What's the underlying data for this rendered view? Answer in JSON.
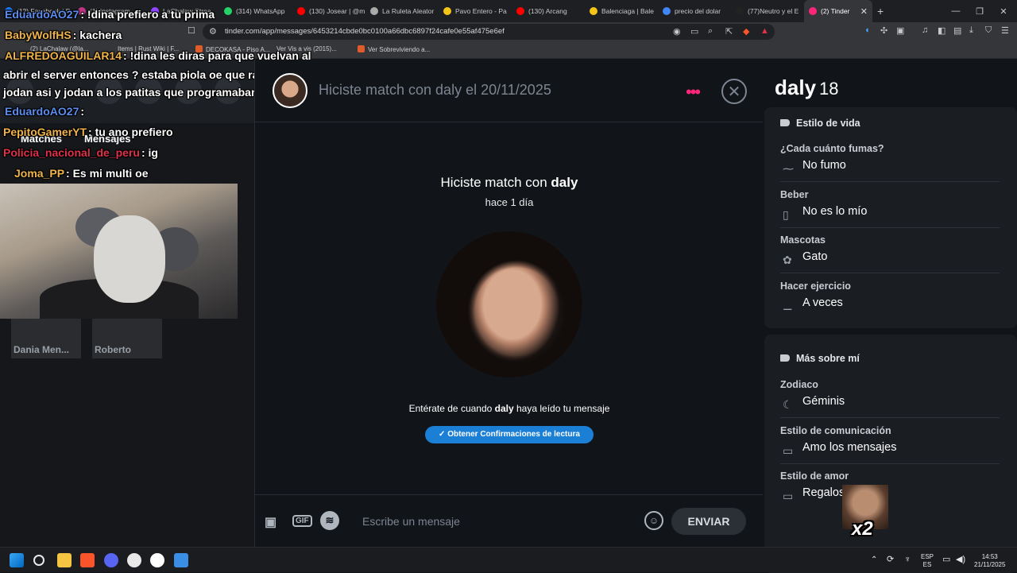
{
  "browser": {
    "tabs": [
      {
        "label": "(12) Facebook | P",
        "color": "#1877f2"
      },
      {
        "label": "(1) Instagram",
        "color": "#c13584"
      },
      {
        "label": "LaChalaw Strea",
        "color": "#9146ff"
      },
      {
        "label": "(314) WhatsApp",
        "color": "#25d366"
      },
      {
        "label": "(130) Josear | @m",
        "color": "#ff0000"
      },
      {
        "label": "La Ruleta Aleator",
        "color": "#aaaaaa"
      },
      {
        "label": "Pavo Entero - Pa",
        "color": "#f5c518"
      },
      {
        "label": "(130) Arcang",
        "color": "#ff0000"
      },
      {
        "label": "Balenciaga | Bale",
        "color": "#f5c518"
      },
      {
        "label": "precio del dolar",
        "color": "#4285f4"
      },
      {
        "label": "(77)Neutro y el E",
        "color": "#222222"
      }
    ],
    "active_tab": {
      "label": "(2) Tinder",
      "color": "#fd267a",
      "close": "✕"
    },
    "new_tab": "+",
    "url": "tinder.com/app/messages/6453214cbde0bc0100a66dbc6897f24cafe0e55af475e6ef",
    "bookmarks": [
      "(2) LaChalaw (@la...",
      "Items | Rust Wiki | F...",
      "DECOKASA - Piso A...",
      "Ver Vis a vis (2015)...",
      "Ver Sobreviviendo a..."
    ]
  },
  "stream_overlay": {
    "chat": [
      {
        "user": "EduardoAO27",
        "user_color": "#5b8def",
        "text": ": !dina prefiero a tu prima"
      },
      {
        "user": "BabyWolfHS",
        "user_color": "#f0b44a",
        "text": ": kachera"
      },
      {
        "user": "ALFREDOAGUILAR14",
        "user_color": "#f0b44a",
        "text": ": !dina les diras para que vuelvan al"
      },
      {
        "user": "",
        "user_color": "#ffffff",
        "text": "abrir el server entonces ? estaba piola oe que rabia que te"
      },
      {
        "user": "",
        "user_color": "#ffffff",
        "text": "jodan asi y jodan a los patitas que programaban"
      },
      {
        "user": "EduardoAO27",
        "user_color": "#5b8def",
        "text": ":"
      },
      {
        "user": "PepitoGamerYT",
        "user_color": "#f0b44a",
        "text": ": tu ano prefiero"
      },
      {
        "user": "Policia_nacional_de_peru",
        "user_color": "#e0304a",
        "text": ": ig"
      },
      {
        "user": "Joma_PP",
        "user_color": "#f0b44a",
        "text": ": Es mi multi oe"
      }
    ],
    "meme_text": "x2"
  },
  "tinder": {
    "left_tabs": [
      "Matches",
      "Mensajes"
    ],
    "thumb_names": [
      "Dania Men...",
      "Roberto"
    ],
    "header_title": "Hiciste match con daly el 20/11/2025",
    "menu_icon": "•••",
    "close_icon": "✕",
    "match_prefix": "Hiciste match con ",
    "match_name": "daly",
    "match_ago": "hace 1 día",
    "read_prefix": "Entérate de cuando ",
    "read_suffix": " haya leído tu mensaje",
    "read_button": "Obtener Confirmaciones de lectura",
    "composer": {
      "gif_label": "GIF",
      "placeholder": "Escribe un mensaje",
      "send_label": "ENVIAR"
    },
    "profile": {
      "name": "daly",
      "age": "18",
      "lifestyle_title": "Estilo de vida",
      "lifestyle": [
        {
          "q": "¿Cada cuánto fumas?",
          "a": "No fumo",
          "icon": "⁓"
        },
        {
          "q": "Beber",
          "a": "No es lo mío",
          "icon": "▯"
        },
        {
          "q": "Mascotas",
          "a": "Gato",
          "icon": "✿"
        },
        {
          "q": "Hacer ejercicio",
          "a": "A veces",
          "icon": "⚊"
        }
      ],
      "more_title": "Más sobre mí",
      "more": [
        {
          "q": "Zodiaco",
          "a": "Géminis",
          "icon": "☾"
        },
        {
          "q": "Estilo de comunicación",
          "a": "Amo los mensajes",
          "icon": "▭"
        },
        {
          "q": "Estilo de amor",
          "a": "Regalos",
          "icon": "▭"
        }
      ]
    }
  },
  "taskbar": {
    "lang": "ESP",
    "lang_sub": "ES",
    "time": "14:53",
    "date": "21/11/2025"
  }
}
